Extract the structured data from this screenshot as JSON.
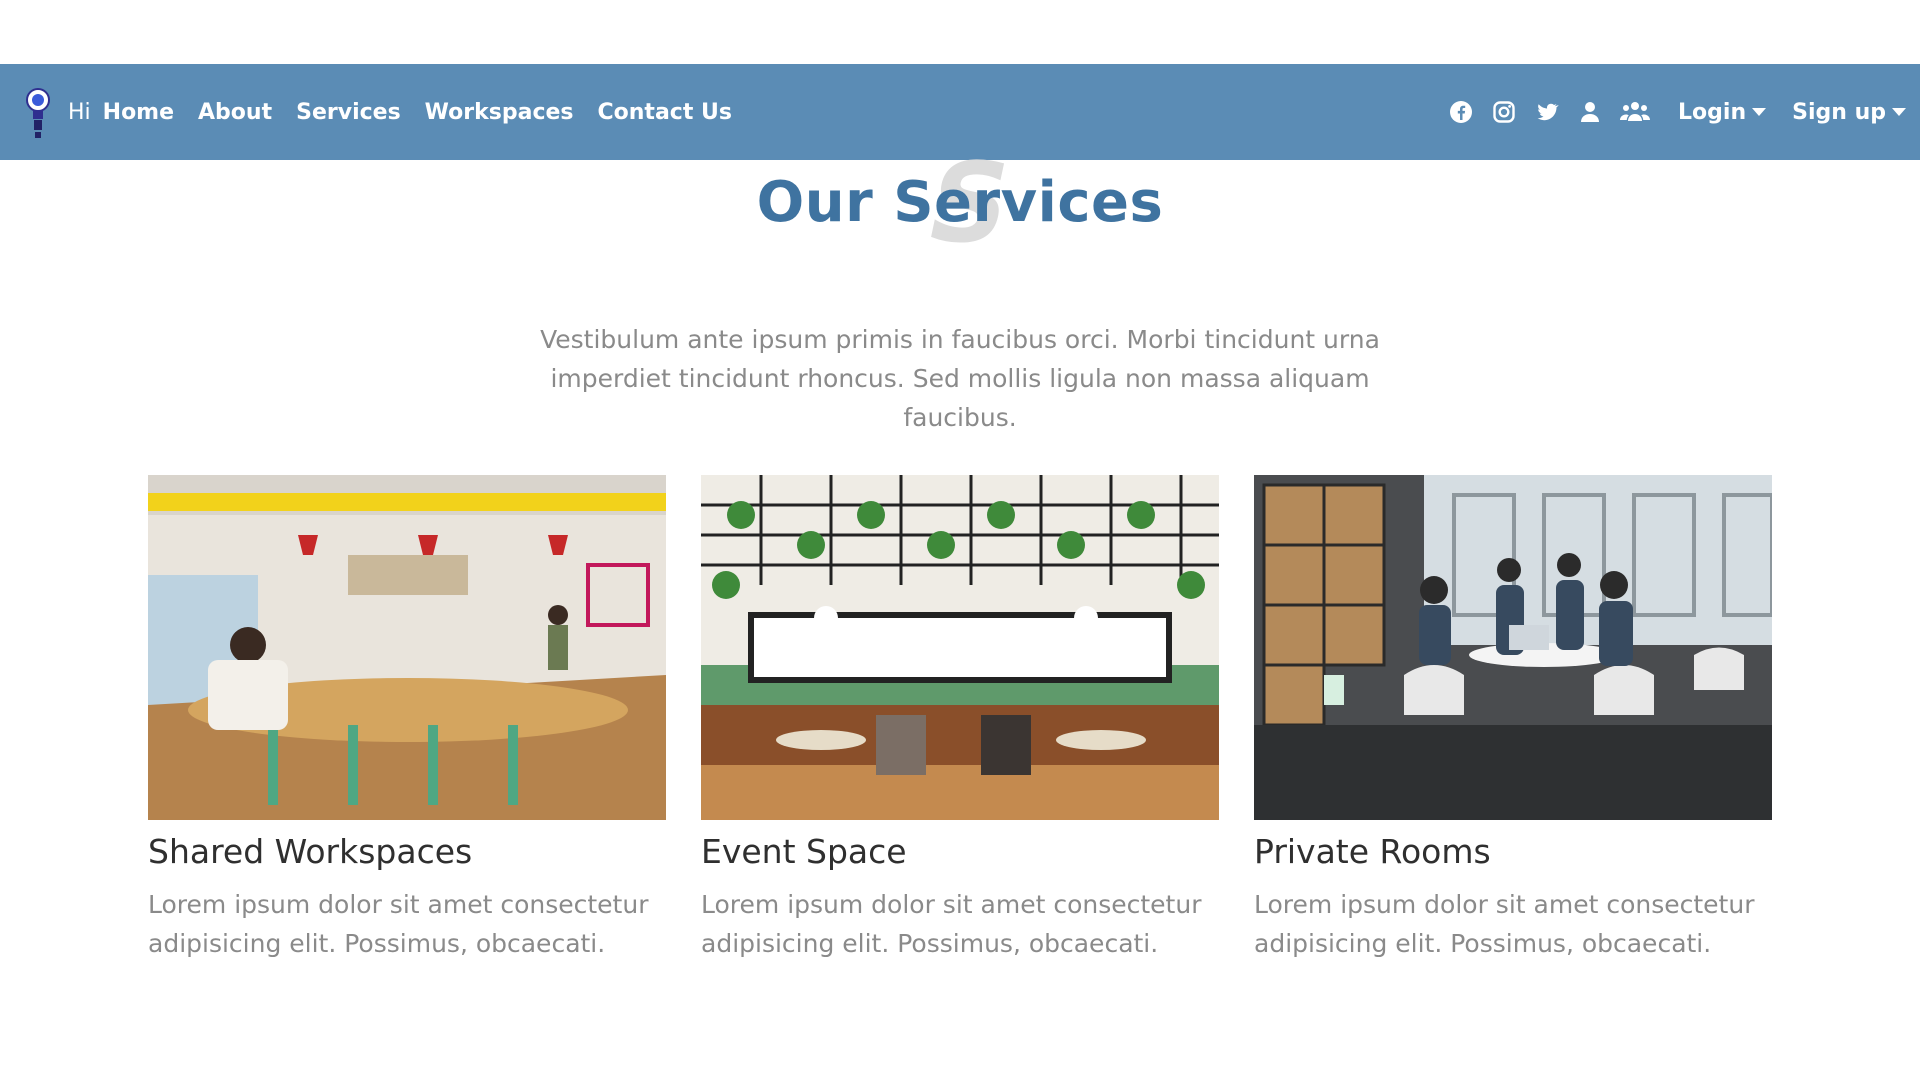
{
  "navbar": {
    "greeting": "Hi",
    "links": [
      "Home",
      "About",
      "Services",
      "Workspaces",
      "Contact Us"
    ],
    "icons": [
      "facebook-icon",
      "instagram-icon",
      "twitter-icon",
      "user-icon",
      "users-icon"
    ],
    "login_label": "Login",
    "signup_label": "Sign up",
    "color": "#5b8cb5"
  },
  "section": {
    "title": "Our Services",
    "watermark": "S",
    "intro": "Vestibulum ante ipsum primis in faucibus orci. Morbi tincidunt urna imperdiet tincidunt rhoncus. Sed mollis ligula non massa aliquam faucibus.",
    "title_color": "#3f73a0"
  },
  "cards": [
    {
      "title": "Shared Workspaces",
      "text": "Lorem ipsum dolor sit amet consectetur adipisicing elit. Possimus, obcaecati."
    },
    {
      "title": "Event Space",
      "text": "Lorem ipsum dolor sit amet consectetur adipisicing elit. Possimus, obcaecati."
    },
    {
      "title": "Private Rooms",
      "text": "Lorem ipsum dolor sit amet consectetur adipisicing elit. Possimus, obcaecati."
    }
  ]
}
